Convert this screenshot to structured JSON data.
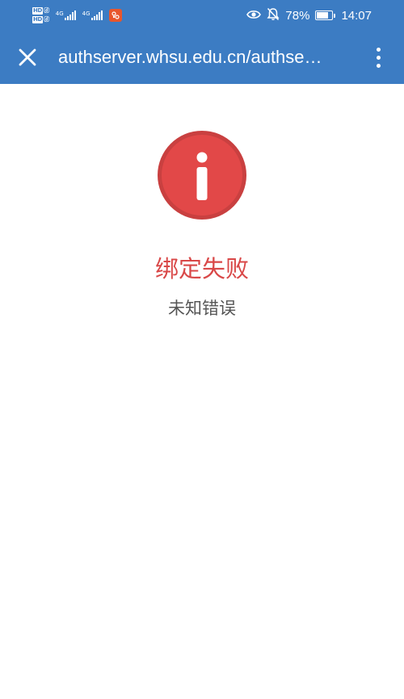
{
  "status_bar": {
    "hd_1": "HD",
    "hd_2": "HD",
    "net_1": "4G",
    "net_2": "4G",
    "battery_percent": "78%",
    "battery_level": 0.78,
    "time": "14:07",
    "icons": [
      "eye-icon",
      "bell-off-icon",
      "battery-icon",
      "app-badge-icon"
    ]
  },
  "toolbar": {
    "url": "authserver.whsu.edu.cn/authse…",
    "close_icon": "close-icon",
    "more_icon": "more-vertical-icon"
  },
  "message": {
    "title": "绑定失败",
    "subtitle": "未知错误",
    "icon": "info-icon",
    "accent_color": "#e04848"
  },
  "colors": {
    "bar": "#3c7cc3",
    "title": "#d94848",
    "subtitle": "#555555"
  }
}
